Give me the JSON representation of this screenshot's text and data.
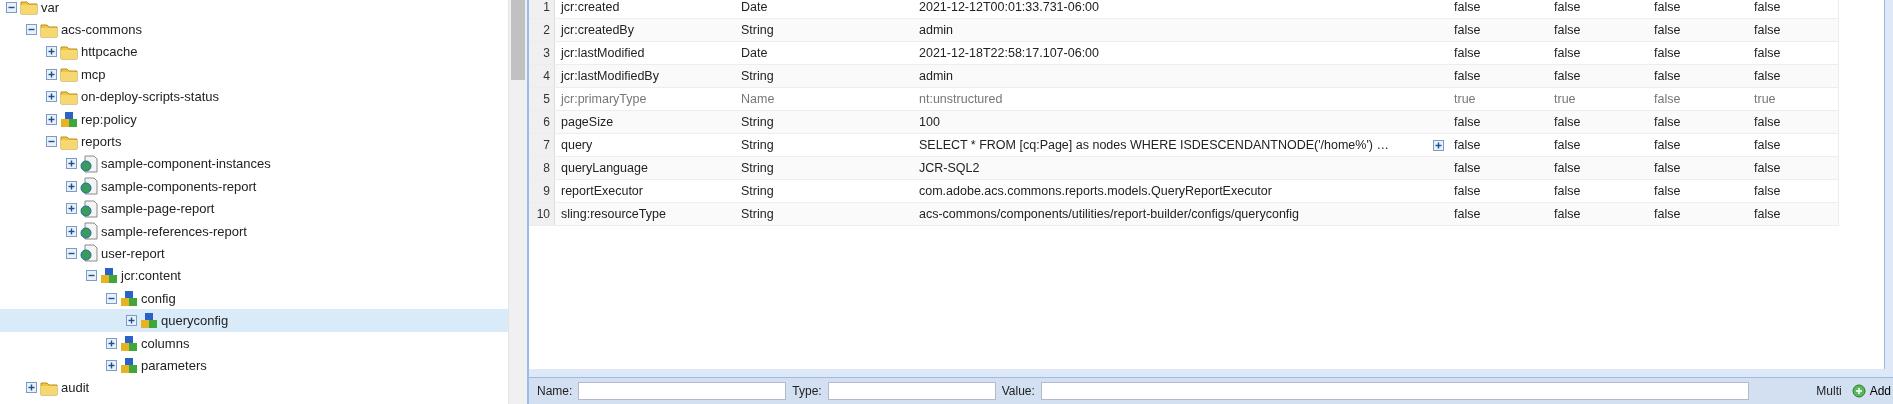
{
  "tree": [
    {
      "label": "var",
      "kind": "folder",
      "expanded": true,
      "selected": false,
      "children": [
        {
          "label": "acs-commons",
          "kind": "folder",
          "expanded": true,
          "selected": false,
          "children": [
            {
              "label": "httpcache",
              "kind": "folder",
              "expanded": false,
              "selected": false
            },
            {
              "label": "mcp",
              "kind": "folder",
              "expanded": false,
              "selected": false
            },
            {
              "label": "on-deploy-scripts-status",
              "kind": "folder",
              "expanded": false,
              "selected": false
            },
            {
              "label": "rep:policy",
              "kind": "node",
              "expanded": false,
              "selected": false
            },
            {
              "label": "reports",
              "kind": "folder",
              "expanded": true,
              "selected": false,
              "children": [
                {
                  "label": "sample-component-instances",
                  "kind": "page",
                  "expanded": false,
                  "selected": false
                },
                {
                  "label": "sample-components-report",
                  "kind": "page",
                  "expanded": false,
                  "selected": false
                },
                {
                  "label": "sample-page-report",
                  "kind": "page",
                  "expanded": false,
                  "selected": false
                },
                {
                  "label": "sample-references-report",
                  "kind": "page",
                  "expanded": false,
                  "selected": false
                },
                {
                  "label": "user-report",
                  "kind": "page",
                  "expanded": true,
                  "selected": false,
                  "children": [
                    {
                      "label": "jcr:content",
                      "kind": "node",
                      "expanded": true,
                      "selected": false,
                      "children": [
                        {
                          "label": "config",
                          "kind": "node",
                          "expanded": true,
                          "selected": false,
                          "children": [
                            {
                              "label": "queryconfig",
                              "kind": "node",
                              "expanded": false,
                              "selected": true
                            }
                          ]
                        },
                        {
                          "label": "columns",
                          "kind": "node",
                          "expanded": false,
                          "selected": false
                        },
                        {
                          "label": "parameters",
                          "kind": "node",
                          "expanded": false,
                          "selected": false
                        }
                      ]
                    }
                  ]
                }
              ]
            }
          ]
        },
        {
          "label": "audit",
          "kind": "folder",
          "expanded": false,
          "selected": false
        }
      ]
    }
  ],
  "properties": [
    {
      "number": "1",
      "name": "jcr:created",
      "type": "Date",
      "value": "2021-12-12T00:01:33.731-06:00",
      "more": false,
      "protected": false,
      "flags": [
        "false",
        "false",
        "false",
        "false"
      ]
    },
    {
      "number": "2",
      "name": "jcr:createdBy",
      "type": "String",
      "value": "admin",
      "more": false,
      "protected": false,
      "flags": [
        "false",
        "false",
        "false",
        "false"
      ]
    },
    {
      "number": "3",
      "name": "jcr:lastModified",
      "type": "Date",
      "value": "2021-12-18T22:58:17.107-06:00",
      "more": false,
      "protected": false,
      "flags": [
        "false",
        "false",
        "false",
        "false"
      ]
    },
    {
      "number": "4",
      "name": "jcr:lastModifiedBy",
      "type": "String",
      "value": "admin",
      "more": false,
      "protected": false,
      "flags": [
        "false",
        "false",
        "false",
        "false"
      ]
    },
    {
      "number": "5",
      "name": "jcr:primaryType",
      "type": "Name",
      "value": "nt:unstructured",
      "more": false,
      "protected": true,
      "flags": [
        "true",
        "true",
        "false",
        "true"
      ]
    },
    {
      "number": "6",
      "name": "pageSize",
      "type": "String",
      "value": "100",
      "more": false,
      "protected": false,
      "flags": [
        "false",
        "false",
        "false",
        "false"
      ]
    },
    {
      "number": "7",
      "name": "query",
      "type": "String",
      "value": "SELECT * FROM [cq:Page] as nodes WHERE ISDESCENDANTNODE('/home%') …",
      "more": true,
      "protected": false,
      "flags": [
        "false",
        "false",
        "false",
        "false"
      ]
    },
    {
      "number": "8",
      "name": "queryLanguage",
      "type": "String",
      "value": "JCR-SQL2",
      "more": false,
      "protected": false,
      "flags": [
        "false",
        "false",
        "false",
        "false"
      ]
    },
    {
      "number": "9",
      "name": "reportExecutor",
      "type": "String",
      "value": "com.adobe.acs.commons.reports.models.QueryReportExecutor",
      "more": false,
      "protected": false,
      "flags": [
        "false",
        "false",
        "false",
        "false"
      ]
    },
    {
      "number": "10",
      "name": "sling:resourceType",
      "type": "String",
      "value": "acs-commons/components/utilities/report-builder/configs/queryconfig",
      "more": false,
      "protected": false,
      "flags": [
        "false",
        "false",
        "false",
        "false"
      ]
    }
  ],
  "add_bar": {
    "name_label": "Name:",
    "type_label": "Type:",
    "value_label": "Value:",
    "multi_label": "Multi",
    "add_button": "Add"
  }
}
